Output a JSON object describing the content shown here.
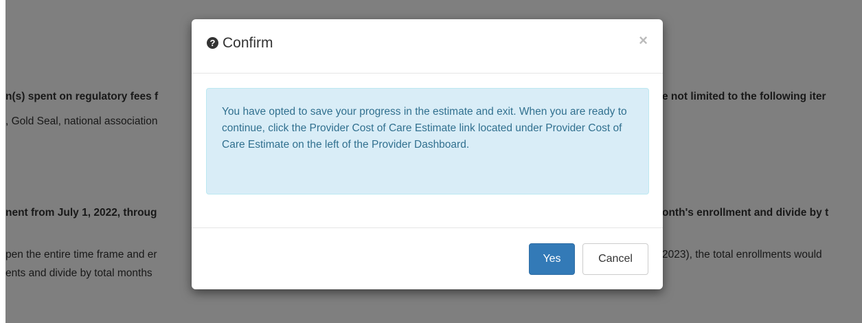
{
  "background": {
    "line1": "n(s) spent on regulatory fees f",
    "line1_right": "e not limited to the following iter",
    "line2": ", Gold Seal, national association",
    "line3": "nent from July 1, 2022, throug",
    "line3_right": "onth's enrollment and divide by t",
    "line4": "pen the entire time frame and er",
    "line4_right": "2023), the total enrollments would",
    "line5": "ents and divide by total months"
  },
  "modal": {
    "title": "Confirm",
    "close_symbol": "×",
    "icon": "question-circle-icon",
    "message": "You have opted to save your progress in the estimate and exit. When you are ready to continue, click the Provider Cost of Care Estimate link located under Provider Cost of Care Estimate on the left of the Provider Dashboard.",
    "yes_label": "Yes",
    "cancel_label": "Cancel"
  },
  "colors": {
    "primary": "#337ab7",
    "alert_bg": "#d9edf7",
    "alert_text": "#31708f"
  }
}
